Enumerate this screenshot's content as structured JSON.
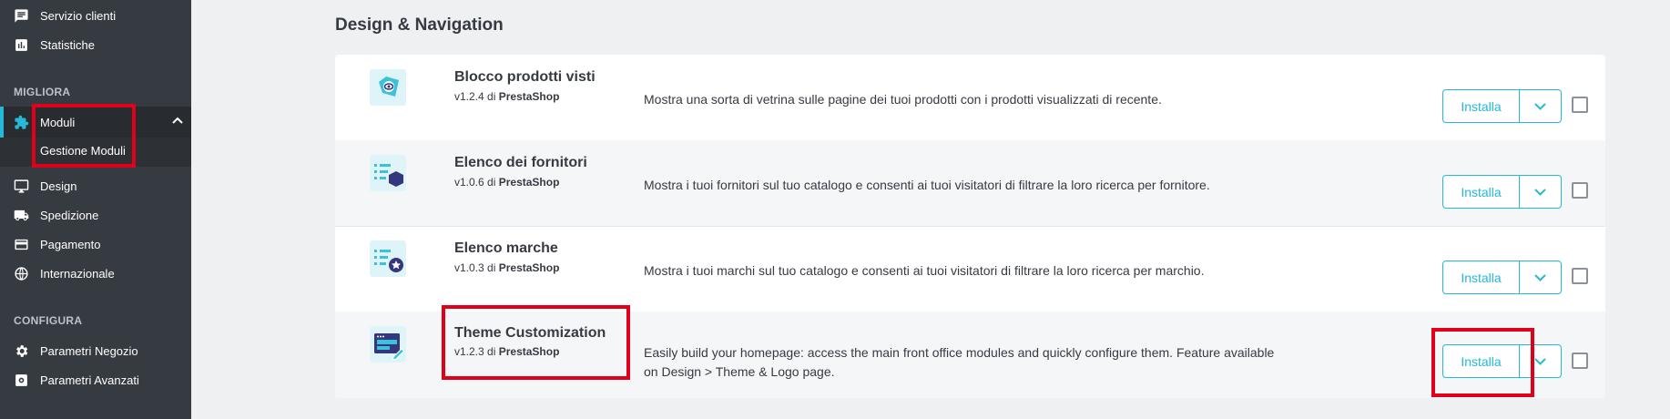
{
  "sidebar": {
    "top_items": [
      {
        "label": "Servizio clienti",
        "icon": "chat-icon"
      },
      {
        "label": "Statistiche",
        "icon": "chart-icon"
      }
    ],
    "section_migliora": "MIGLIORA",
    "modules": {
      "label": "Moduli",
      "icon": "puzzle-icon",
      "submenu": "Gestione Moduli"
    },
    "items_after": [
      {
        "label": "Design",
        "icon": "monitor-icon"
      },
      {
        "label": "Spedizione",
        "icon": "truck-icon"
      },
      {
        "label": "Pagamento",
        "icon": "credit-card-icon"
      },
      {
        "label": "Internazionale",
        "icon": "globe-icon"
      }
    ],
    "section_configura": "CONFIGURA",
    "config_items": [
      {
        "label": "Parametri Negozio",
        "icon": "gear-icon"
      },
      {
        "label": "Parametri Avanzati",
        "icon": "advanced-settings-icon"
      }
    ]
  },
  "main": {
    "section_title": "Design & Navigation",
    "modules": [
      {
        "name": "Blocco prodotti visti",
        "version": "v1.2.4",
        "by": "di",
        "author": "PrestaShop",
        "description": "Mostra una sorta di vetrina sulle pagine dei tuoi prodotti con i prodotti visualizzati di recente.",
        "action": "Installa",
        "icon": "viewed-products-icon"
      },
      {
        "name": "Elenco dei fornitori",
        "version": "v1.0.6",
        "by": "di",
        "author": "PrestaShop",
        "description": "Mostra i tuoi fornitori sul tuo catalogo e consenti ai tuoi visitatori di filtrare la loro ricerca per fornitore.",
        "action": "Installa",
        "icon": "suppliers-list-icon"
      },
      {
        "name": "Elenco marche",
        "version": "v1.0.3",
        "by": "di",
        "author": "PrestaShop",
        "description": "Mostra i tuoi marchi sul tuo catalogo e consenti ai tuoi visitatori di filtrare la loro ricerca per marchio.",
        "action": "Installa",
        "icon": "brands-list-icon"
      },
      {
        "name": "Theme Customization",
        "version": "v1.2.3",
        "by": "di",
        "author": "PrestaShop",
        "description": "Easily build your homepage: access the main front office modules and quickly configure them. Feature available on Design > Theme & Logo page.",
        "action": "Installa",
        "icon": "theme-customization-icon"
      }
    ]
  },
  "colors": {
    "sidebar_bg": "#363a41",
    "accent": "#25b9d7",
    "highlight": "#e0001a"
  }
}
